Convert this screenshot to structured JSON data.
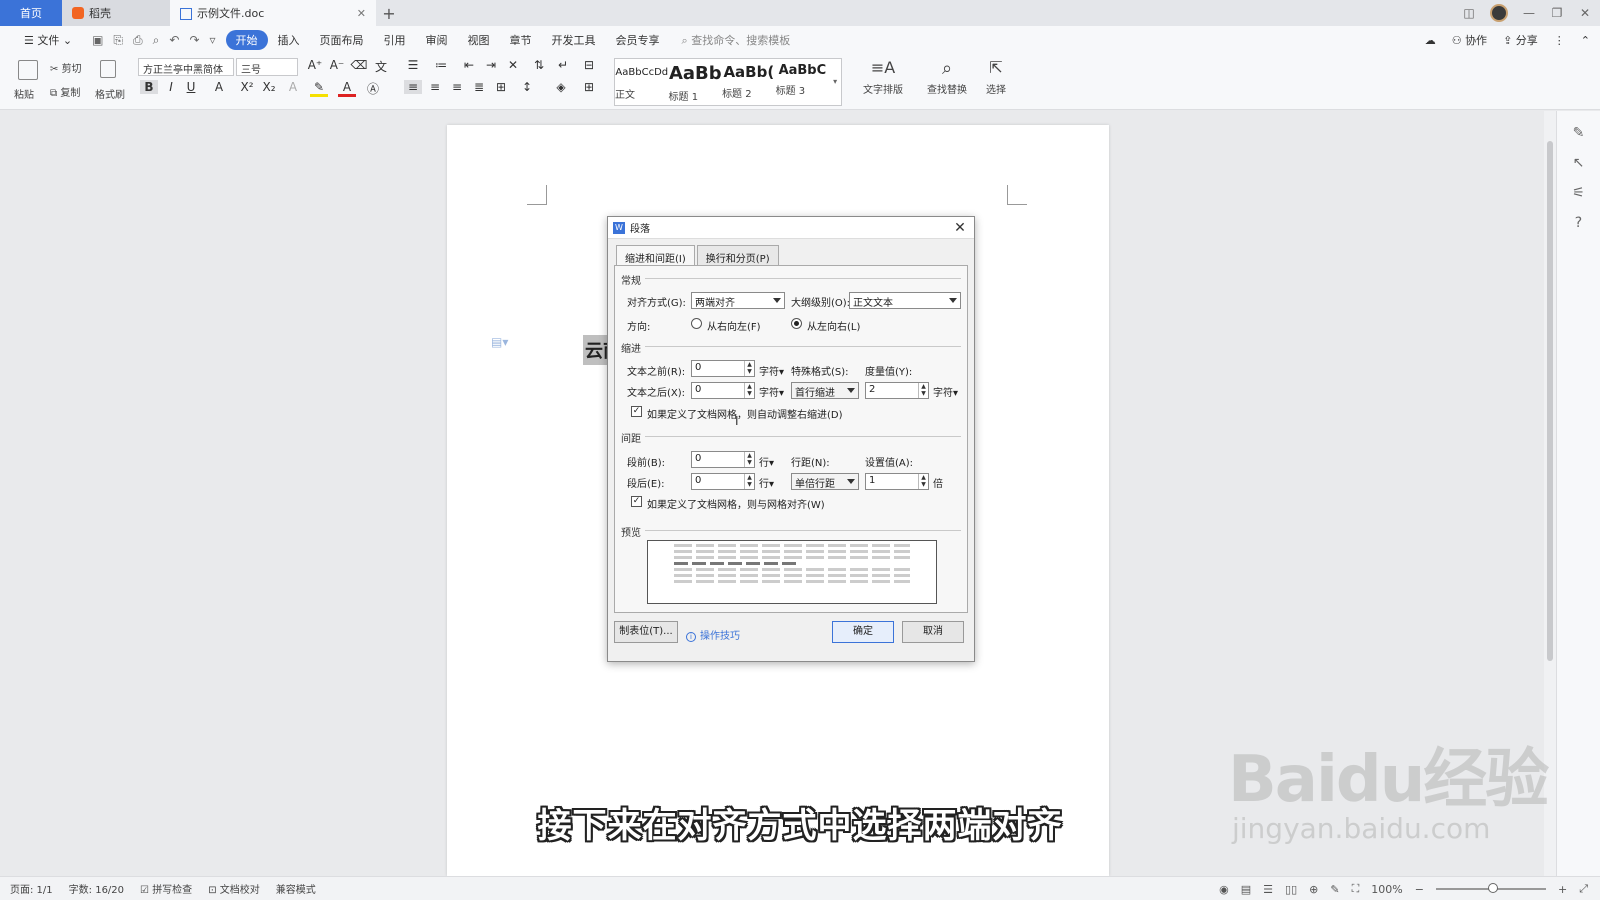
{
  "tabs": {
    "home": "首页",
    "daoke": "稻壳",
    "doc": "示例文件.doc",
    "add": "+"
  },
  "menu": {
    "file": "文件",
    "items": [
      "开始",
      "插入",
      "页面布局",
      "引用",
      "审阅",
      "视图",
      "章节",
      "开发工具",
      "会员专享"
    ],
    "search_placeholder": "查找命令、搜索模板",
    "sync": "协作",
    "share": "分享"
  },
  "ribbon": {
    "paste": "粘贴",
    "cut": "剪切",
    "copy": "复制",
    "format_painter": "格式刷",
    "font_name": "方正兰亭中黑简体",
    "font_size": "三号",
    "styles": [
      {
        "preview": "AaBbCcDd",
        "label": "正文"
      },
      {
        "preview": "AaBb",
        "label": "标题 1"
      },
      {
        "preview": "AaBb(",
        "label": "标题 2"
      },
      {
        "preview": "AaBbC",
        "label": "标题 3"
      }
    ],
    "text_layout": "文字排版",
    "find_replace": "查找替换",
    "select": "选择"
  },
  "document": {
    "heading_fragment": "云南"
  },
  "dialog": {
    "title": "段落",
    "tab_indent": "缩进和间距(I)",
    "tab_break": "换行和分页(P)",
    "general": "常规",
    "align_label": "对齐方式(G):",
    "align_value": "两端对齐",
    "outline_label": "大纲级别(O):",
    "outline_value": "正文文本",
    "direction_label": "方向:",
    "rtl": "从右向左(F)",
    "ltr": "从左向右(L)",
    "indent": "缩进",
    "before_text_label": "文本之前(R):",
    "before_text_value": "0",
    "after_text_label": "文本之后(X):",
    "after_text_value": "0",
    "unit_char": "字符",
    "special_label": "特殊格式(S):",
    "special_value": "首行缩进",
    "measure_label": "度量值(Y):",
    "measure_value": "2",
    "auto_indent_check": "如果定义了文档网格，则自动调整右缩进(D)",
    "spacing": "间距",
    "before_label": "段前(B):",
    "before_value": "0",
    "after_label": "段后(E):",
    "after_value": "0",
    "unit_line": "行",
    "line_spacing_label": "行距(N):",
    "line_spacing_value": "单倍行距",
    "set_value_label": "设置值(A):",
    "set_value": "1",
    "unit_times": "倍",
    "grid_align_check": "如果定义了文档网格，则与网格对齐(W)",
    "preview": "预览",
    "tabs_button": "制表位(T)...",
    "tips": "操作技巧",
    "ok": "确定",
    "cancel": "取消"
  },
  "status": {
    "page": "页面: 1/1",
    "words": "字数: 16/20",
    "spell": "拼写检查",
    "proof": "文档校对",
    "compat": "兼容模式",
    "zoom": "100%"
  },
  "subtitle": "接下来在对齐方式中选择两端对齐",
  "watermark": {
    "main": "Baidu经验",
    "sub": "jingyan.baidu.com"
  },
  "colors": {
    "accent": "#3b73d8"
  }
}
